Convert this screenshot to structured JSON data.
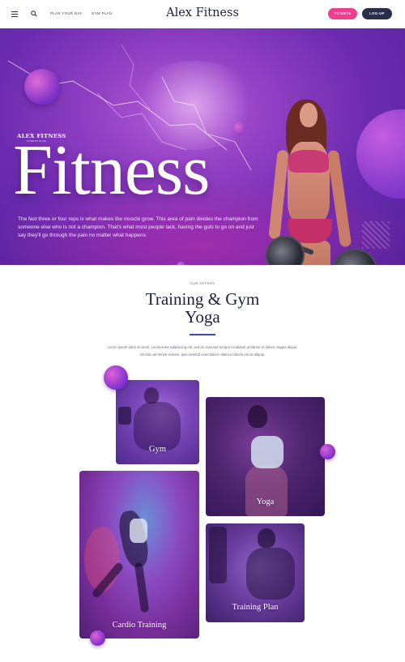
{
  "header": {
    "menu_icon": "hamburger-icon",
    "search_icon": "search-icon",
    "nav": [
      "PLAN YOUR DAY",
      "GYM PLAN"
    ],
    "logo": "Alex Fitness",
    "tickets_label": "TICKETS",
    "login_label": "LOG-UP",
    "colors": {
      "tickets": "#ec3f8e",
      "login": "#2b2e4a"
    }
  },
  "hero": {
    "brand": "ALEX FITNESS",
    "brand_sub": "FITNESS CLUB",
    "title": "Fitness",
    "text": "The fast three or four reps is what makes the muscle grow. This area of pain divides the champion from someone else who is not a champion. That's what most people lack, having the guts to go on and just say they'll go through the pain no matter what happens.",
    "colors": {
      "primary": "#8f3fc2",
      "accent": "#ec3f8e"
    }
  },
  "offers": {
    "kicker": "OUR OFFERS",
    "title_line1": "Training & Gym",
    "title_line2": "Yoga",
    "description": "Lorem ipsum dolor sit amet, consectetur adipisicing elit, sed do eiusmod tempor incididunt ut labore et dolore magna aliqua. Ut enim ad minim veniam, quis nostrud exercitation ullamco laboris nisi ut aliquip.",
    "cards": [
      {
        "label": "Gym"
      },
      {
        "label": "Yoga"
      },
      {
        "label": "Cardio Training"
      },
      {
        "label": "Training Plan"
      }
    ]
  }
}
